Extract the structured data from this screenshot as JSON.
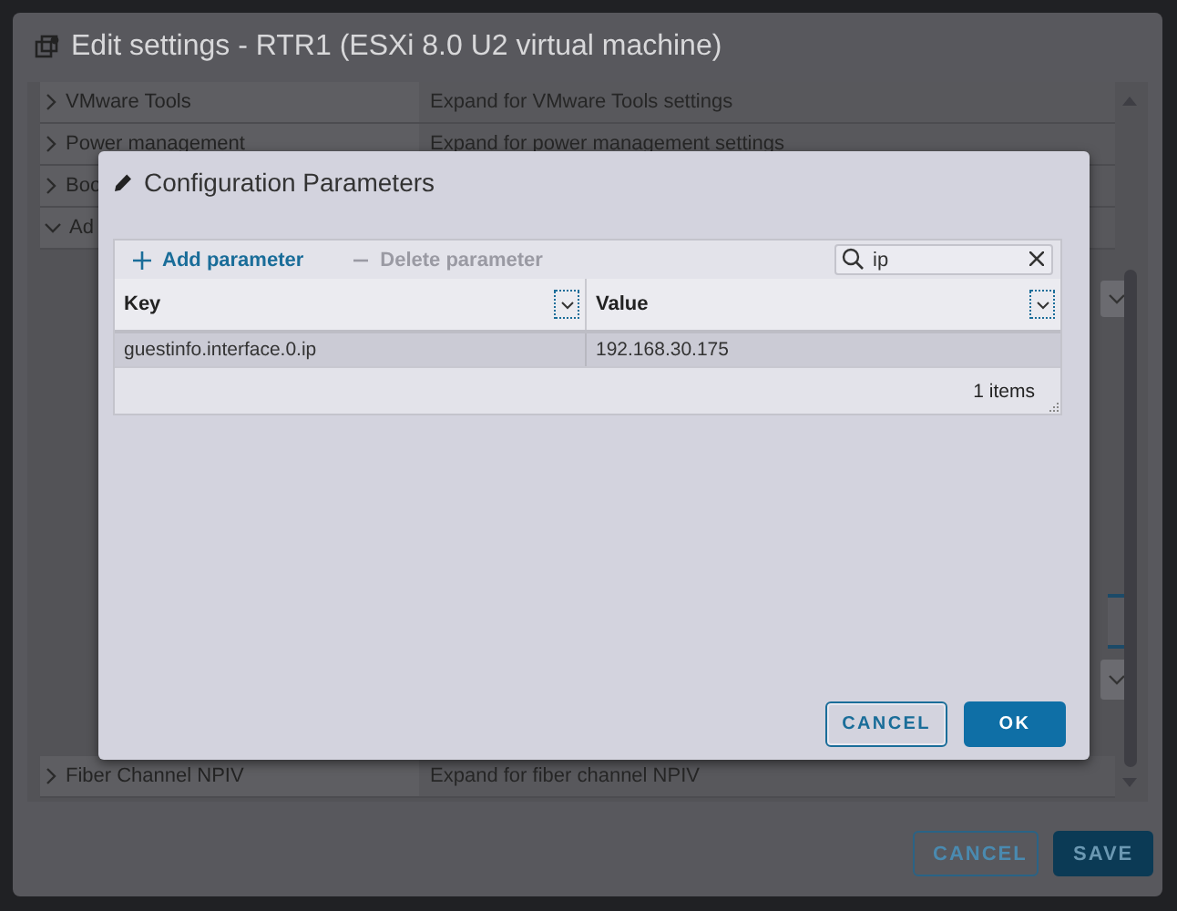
{
  "window": {
    "title": "Edit settings - RTR1 (ESXi 8.0 U2 virtual machine)"
  },
  "settings_rows": [
    {
      "label": "VMware Tools",
      "value": "Expand for VMware Tools settings",
      "expanded": false
    },
    {
      "label": "Power management",
      "value": "Expand for power management settings",
      "expanded": false
    },
    {
      "label": "Boo",
      "expanded": false
    },
    {
      "label": "Ad",
      "expanded": true
    },
    {
      "label": "Fiber Channel NPIV",
      "value": "Expand for fiber channel NPIV",
      "expanded": false
    }
  ],
  "footer_buttons": [
    {
      "label": "CANCEL",
      "kind": "outline"
    },
    {
      "label": "SAVE",
      "kind": "primary"
    }
  ],
  "modal": {
    "title": "Configuration Parameters",
    "toolbar": [
      {
        "label": "Add parameter",
        "kind": "add",
        "disabled": false
      },
      {
        "label": "Delete parameter",
        "kind": "delete",
        "disabled": true
      }
    ],
    "search": {
      "value": "ip"
    },
    "columns": [
      "Key",
      "Value"
    ],
    "rows": [
      {
        "key": "guestinfo.interface.0.ip",
        "value": "192.168.30.175",
        "selected": true
      }
    ],
    "footer": "1 items",
    "buttons": [
      {
        "label": "CANCEL",
        "kind": "outline"
      },
      {
        "label": "OK",
        "kind": "primary"
      }
    ]
  }
}
